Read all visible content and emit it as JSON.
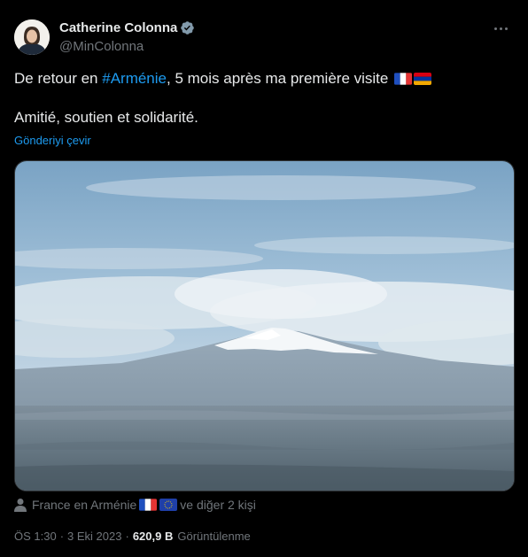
{
  "author": {
    "display_name": "Catherine Colonna",
    "handle": "@MinColonna",
    "verified_icon": "verified-badge-icon"
  },
  "tweet": {
    "line1_before": "De retour en ",
    "hashtag": "#Arménie",
    "line1_after": ", 5 mois après ma première visite",
    "line2": "Amitié, soutien et solidarité.",
    "flags": [
      "flag-france-icon",
      "flag-armenia-icon"
    ]
  },
  "translate_label": "Gönderiyi çevir",
  "media": {
    "alt": "",
    "type": "photo"
  },
  "tagged": {
    "first": "France en Arménie",
    "rest": "ve diğer 2 kişi"
  },
  "meta": {
    "time": "ÖS 1:30",
    "date": "3 Eki 2023",
    "separator": "·",
    "views_count": "620,9 B",
    "views_label": "Görüntülenme"
  },
  "colors": {
    "background": "#000000",
    "text": "#e7e9ea",
    "secondary": "#71767b",
    "accent": "#1d9bf0"
  }
}
